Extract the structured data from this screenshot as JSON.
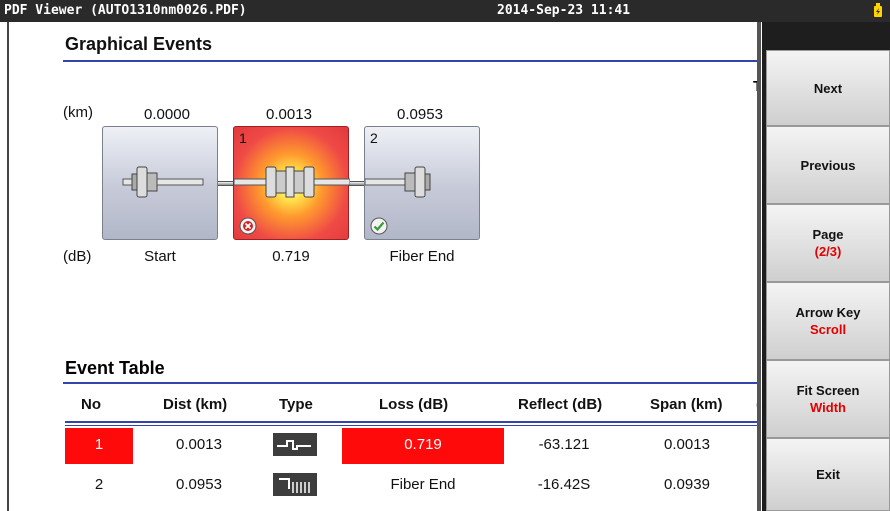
{
  "titlebar": {
    "title": "PDF Viewer (AUTO1310nm0026.PDF)",
    "datetime": "2014-Sep-23 11:41"
  },
  "document": {
    "section_title": "Graphical Events",
    "cut_text": "T",
    "km_unit": "(km)",
    "db_unit": "(dB)",
    "events": [
      {
        "distance": "0.0000",
        "number": "",
        "label": "Start",
        "status": "none"
      },
      {
        "distance": "0.0013",
        "number": "1",
        "label": "0.719",
        "status": "fail"
      },
      {
        "distance": "0.0953",
        "number": "2",
        "label": "Fiber End",
        "status": "pass"
      }
    ],
    "table_title": "Event Table",
    "table_headers": [
      "No",
      "Dist (km)",
      "Type",
      "Loss (dB)",
      "Reflect (dB)",
      "Span (km)",
      "("
    ],
    "rows": [
      {
        "no": "1",
        "dist": "0.0013",
        "type_icon": "splice-event-icon",
        "loss": "0.719",
        "reflect": "-63.121",
        "span": "0.0013",
        "highlight": true
      },
      {
        "no": "2",
        "dist": "0.0953",
        "type_icon": "fiber-end-icon",
        "loss": "Fiber End",
        "reflect": "-16.42S",
        "span": "0.0939",
        "highlight": false
      }
    ]
  },
  "sidebar": {
    "next": "Next",
    "previous": "Previous",
    "page_label": "Page",
    "page_value": "(2/3)",
    "arrow_label": "Arrow Key",
    "arrow_value": "Scroll",
    "fit_label": "Fit Screen",
    "fit_value": "Width",
    "exit": "Exit"
  },
  "colors": {
    "fail_red": "#ff0a0a",
    "rule_blue": "#3344aa",
    "sidebar_highlight": "#e00000"
  }
}
